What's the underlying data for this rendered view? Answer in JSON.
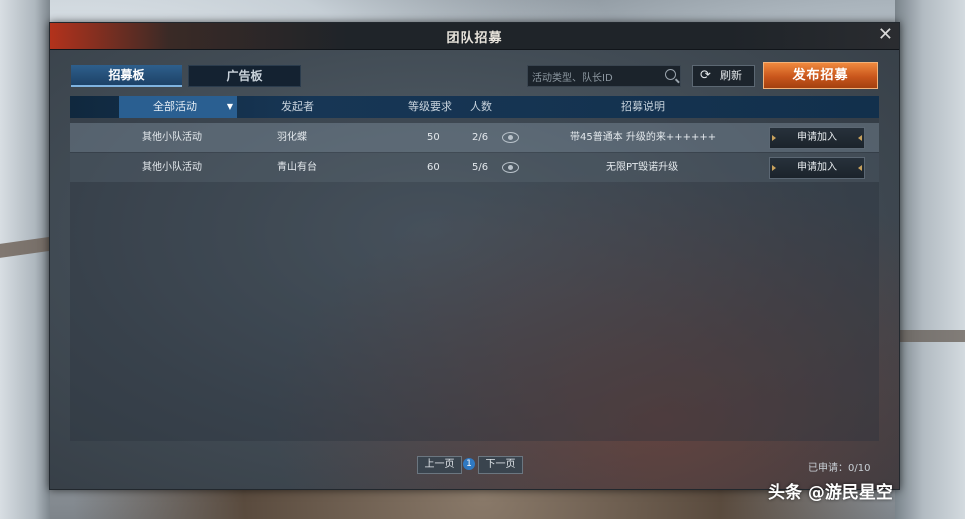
{
  "window": {
    "title": "团队招募",
    "close_label": "✕"
  },
  "tabs": [
    {
      "label": "招募板",
      "active": true
    },
    {
      "label": "广告板",
      "active": false
    }
  ],
  "search": {
    "placeholder": "活动类型、队长ID",
    "value": ""
  },
  "refresh_label": "刷新",
  "publish_label": "发布招募",
  "table": {
    "filter_label": "全部活动",
    "headers": {
      "initiator": "发起者",
      "level": "等级要求",
      "count": "人数",
      "desc": "招募说明"
    },
    "rows": [
      {
        "activity": "其他小队活动",
        "initiator": "羽化蝶",
        "level": "50",
        "count": "2/6",
        "desc": "带45普通本 升级的来++++++",
        "action": "申请加入"
      },
      {
        "activity": "其他小队活动",
        "initiator": "青山有台",
        "level": "60",
        "count": "5/6",
        "desc": "无限PT毁诺升级",
        "action": "申请加入"
      }
    ]
  },
  "pager": {
    "prev": "上一页",
    "current": "1",
    "next": "下一页"
  },
  "applied_text": "已申请：0/10",
  "watermark": "头条 @游民星空",
  "colors": {
    "accent": "#2a5f91",
    "publish": "#d8652a",
    "title_accent": "#b3321c"
  }
}
